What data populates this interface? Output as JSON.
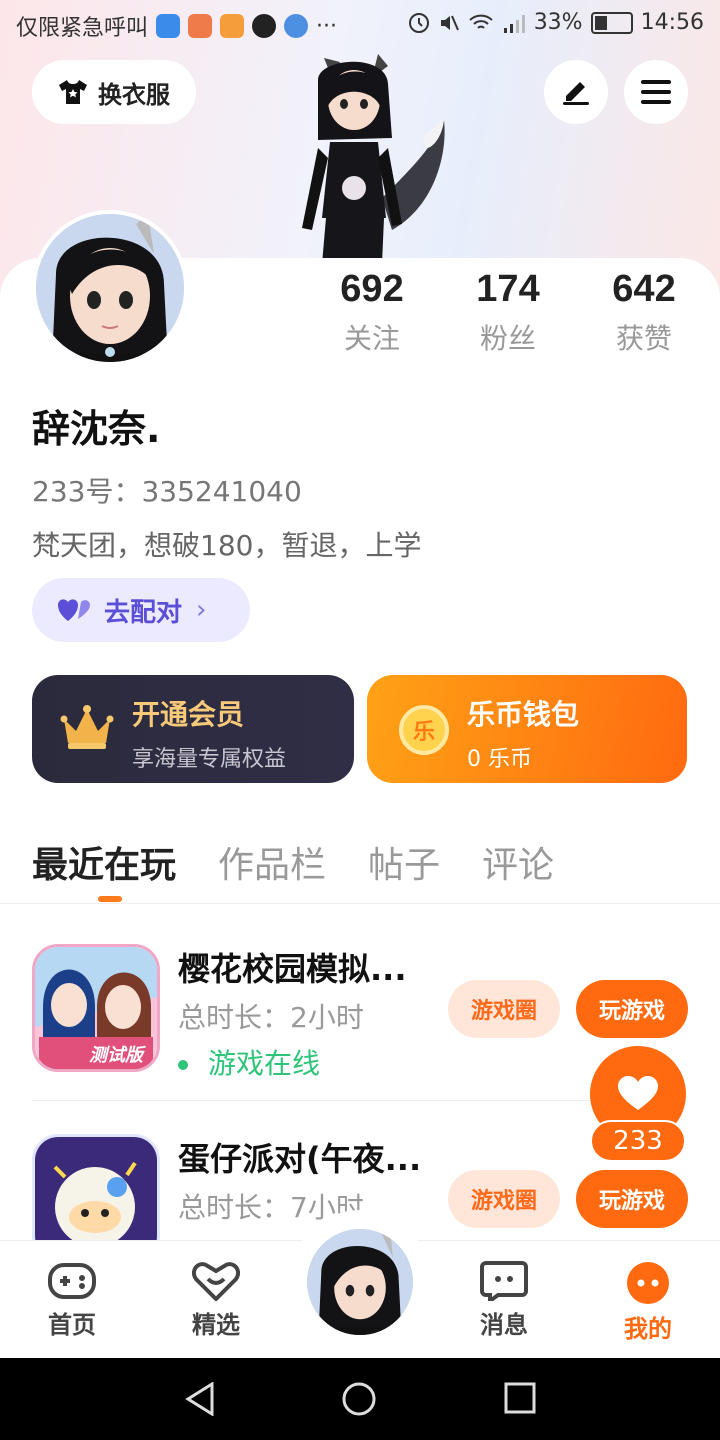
{
  "status_bar": {
    "carrier": "仅限紧急呼叫",
    "more": "···",
    "battery": "33%",
    "time": "14:56"
  },
  "header": {
    "costume_label": "换衣服"
  },
  "profile": {
    "stats": [
      {
        "value": "692",
        "label": "关注"
      },
      {
        "value": "174",
        "label": "粉丝"
      },
      {
        "value": "642",
        "label": "获赞"
      }
    ],
    "username": "辞沈奈.",
    "uid": "233号：335241040",
    "bio": "梵天团，想破180，暂退，上学",
    "match_label": "去配对"
  },
  "promos": {
    "vip": {
      "title": "开通会员",
      "subtitle": "享海量专属权益"
    },
    "wallet": {
      "title": "乐币钱包",
      "subtitle": "0 乐币",
      "coin_char": "乐"
    }
  },
  "tabs": [
    "最近在玩",
    "作品栏",
    "帖子",
    "评论"
  ],
  "games": [
    {
      "name": "樱花校园模拟...",
      "time": "总时长：2小时",
      "status": "游戏在线",
      "circle_label": "游戏圈",
      "play_label": "玩游戏",
      "badge": "测试版"
    },
    {
      "name": "蛋仔派对(午夜...",
      "time": "总时长：7小时",
      "status": "",
      "circle_label": "游戏圈",
      "play_label": "玩游戏"
    }
  ],
  "floating": {
    "count": "233"
  },
  "bottom_nav": [
    {
      "label": "首页",
      "icon": "gamepad-icon"
    },
    {
      "label": "精选",
      "icon": "heart-chat-icon"
    },
    {
      "label": "消息",
      "icon": "message-icon"
    },
    {
      "label": "我的",
      "icon": "profile-face-icon"
    }
  ],
  "colors": {
    "accent": "#ff6a10",
    "online": "#2ec57a",
    "match": "#5a4fd6"
  }
}
